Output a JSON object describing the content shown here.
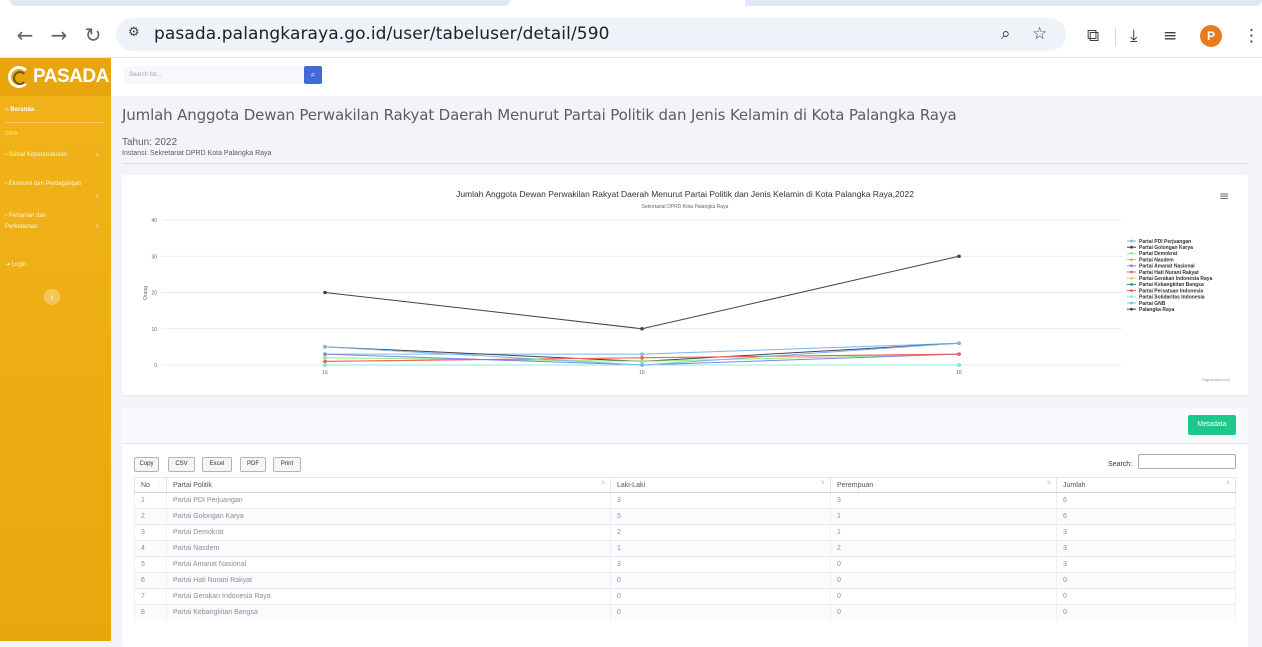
{
  "browser": {
    "url": "pasada.palangkaraya.go.id/user/tabeluser/detail/590",
    "avatar_letter": "P"
  },
  "sidebar": {
    "brand": "PASADA",
    "items": [
      {
        "label": "Beranda",
        "active": true
      },
      {
        "label": "Sosial Kependudukan",
        "chevron": "›"
      },
      {
        "label": "Ekonomi dan Perdagangan",
        "chevron": "›"
      },
      {
        "label": "Pertanian dan",
        "label2": "Perkebunan",
        "chevron": "›"
      },
      {
        "label": "Login"
      }
    ],
    "section_head": "DATA",
    "collapse": "‹"
  },
  "topbar": {
    "search_placeholder": "Search for..."
  },
  "header": {
    "title": "Jumlah Anggota Dewan Perwakilan Rakyat Daerah Menurut Partai Politik dan Jenis Kelamin di Kota Palangka Raya",
    "tahun": "Tahun: 2022",
    "instansi": "Instansi: Sekretariat DPRD Kota Palangka Raya"
  },
  "chart_data": {
    "type": "line",
    "title": "Jumlah Anggota Dewan Perwakilan Rakyat Daerah Menurut Partai Politik dan Jenis Kelamin di Kota Palangka Raya,2022",
    "subtitle": "Sekretariat DPRD Kota Palangka Raya",
    "ylabel": "Orang",
    "xlabel": "",
    "ylim": [
      0,
      40
    ],
    "yticks": [
      0,
      10,
      20,
      30,
      40
    ],
    "categories": [
      "16",
      "16",
      "16"
    ],
    "credit": "Highcharts.com",
    "legend_position": "right",
    "series": [
      {
        "name": "Partai PDI Perjuangan",
        "color": "#7cb5ec",
        "values": [
          3,
          3,
          6
        ]
      },
      {
        "name": "Partai Golongan Karya",
        "color": "#434348",
        "values": [
          5,
          1,
          6
        ]
      },
      {
        "name": "Partai Demokrat",
        "color": "#90ed7d",
        "values": [
          2,
          1,
          3
        ]
      },
      {
        "name": "Partai Nasdem",
        "color": "#f7a35c",
        "values": [
          1,
          2,
          3
        ]
      },
      {
        "name": "Partai Amanat Nasional",
        "color": "#8085e9",
        "values": [
          3,
          0,
          3
        ]
      },
      {
        "name": "Partai Hati Nurani Rakyat",
        "color": "#f15c80",
        "values": [
          0,
          0,
          0
        ]
      },
      {
        "name": "Partai Gerakan Indonesia Raya",
        "color": "#e4d354",
        "values": [
          0,
          0,
          0
        ]
      },
      {
        "name": "Partai Kebangkitan Bangsa",
        "color": "#2b908f",
        "values": [
          0,
          0,
          0
        ]
      },
      {
        "name": "Partai Persatuan Indonesia",
        "color": "#f45b5b",
        "values": [
          1,
          2,
          3
        ]
      },
      {
        "name": "Partai Solidaritas Indonesia",
        "color": "#91e8e1",
        "values": [
          0,
          0,
          0
        ]
      },
      {
        "name": "Partai GNB",
        "color": "#7cb5ec",
        "values": [
          5,
          0,
          6
        ]
      },
      {
        "name": "Palangka Raya",
        "color": "#434348",
        "values": [
          20,
          10,
          30
        ]
      }
    ]
  },
  "table_card": {
    "metadata_label": "Metadata",
    "buttons": [
      "Copy",
      "CSV",
      "Excel",
      "PDF",
      "Print"
    ],
    "search_label": "Search:",
    "columns": [
      "No",
      "Partai Politik",
      "Laki-Laki",
      "Perempuan",
      "Jumlah"
    ],
    "sort_icons": [
      "↑",
      "⇅",
      "⇅",
      "⇅",
      "⇅"
    ],
    "rows": [
      [
        "1",
        "Partai PDI Perjuangan",
        "3",
        "3",
        "6"
      ],
      [
        "2",
        "Partai Golongan Karya",
        "5",
        "1",
        "6"
      ],
      [
        "3",
        "Partai Demokrat",
        "2",
        "1",
        "3"
      ],
      [
        "4",
        "Partai Nasdem",
        "1",
        "2",
        "3"
      ],
      [
        "5",
        "Partai Amanat Nasional",
        "3",
        "0",
        "3"
      ],
      [
        "6",
        "Partai Hati Nurani Rakyat",
        "0",
        "0",
        "0"
      ],
      [
        "7",
        "Partai Gerakan Indonesia Raya",
        "0",
        "0",
        "0"
      ],
      [
        "8",
        "Partai Kebangkitan Bangsa",
        "0",
        "0",
        "0"
      ]
    ]
  }
}
